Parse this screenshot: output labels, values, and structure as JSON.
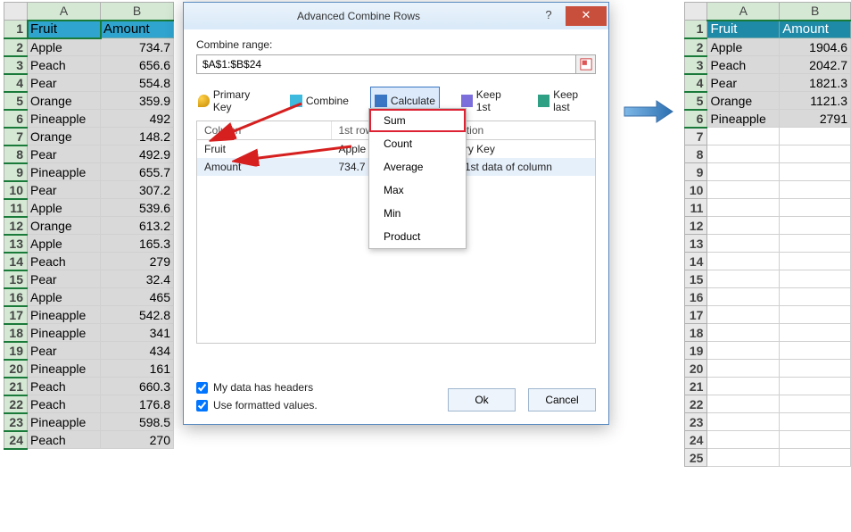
{
  "sheet_left": {
    "columns": [
      "A",
      "B"
    ],
    "headers": [
      "Fruit",
      "Amount"
    ],
    "rows": [
      [
        "Apple",
        "734.7"
      ],
      [
        "Peach",
        "656.6"
      ],
      [
        "Pear",
        "554.8"
      ],
      [
        "Orange",
        "359.9"
      ],
      [
        "Pineapple",
        "492"
      ],
      [
        "Orange",
        "148.2"
      ],
      [
        "Pear",
        "492.9"
      ],
      [
        "Pineapple",
        "655.7"
      ],
      [
        "Pear",
        "307.2"
      ],
      [
        "Apple",
        "539.6"
      ],
      [
        "Orange",
        "613.2"
      ],
      [
        "Apple",
        "165.3"
      ],
      [
        "Peach",
        "279"
      ],
      [
        "Pear",
        "32.4"
      ],
      [
        "Apple",
        "465"
      ],
      [
        "Pineapple",
        "542.8"
      ],
      [
        "Pineapple",
        "341"
      ],
      [
        "Pear",
        "434"
      ],
      [
        "Pineapple",
        "161"
      ],
      [
        "Peach",
        "660.3"
      ],
      [
        "Peach",
        "176.8"
      ],
      [
        "Pineapple",
        "598.5"
      ],
      [
        "Peach",
        "270"
      ]
    ]
  },
  "sheet_right": {
    "columns": [
      "A",
      "B"
    ],
    "headers": [
      "Fruit",
      "Amount"
    ],
    "rows": [
      [
        "Apple",
        "1904.6"
      ],
      [
        "Peach",
        "2042.7"
      ],
      [
        "Pear",
        "1821.3"
      ],
      [
        "Orange",
        "1121.3"
      ],
      [
        "Pineapple",
        "2791"
      ]
    ],
    "empty_rows": 19
  },
  "dialog": {
    "title": "Advanced Combine Rows",
    "help": "?",
    "close": "✕",
    "combine_range_label": "Combine range:",
    "combine_range_value": "$A$1:$B$24",
    "modes": {
      "primary_key": "Primary Key",
      "combine": "Combine",
      "calculate": "Calculate",
      "keep_first": "Keep 1st",
      "keep_last": "Keep last"
    },
    "columns_header": {
      "col": "Column",
      "first": "1st row",
      "op": "Operation"
    },
    "columns": [
      {
        "name": "Fruit",
        "first": "Apple",
        "op": "Primary Key"
      },
      {
        "name": "Amount",
        "first": "734.7",
        "op": "Keep 1st data of column"
      }
    ],
    "dropdown_items": [
      "Sum",
      "Count",
      "Average",
      "Max",
      "Min",
      "Product"
    ],
    "chk_headers": "My data has headers",
    "chk_formatted": "Use formatted values.",
    "ok": "Ok",
    "cancel": "Cancel"
  }
}
